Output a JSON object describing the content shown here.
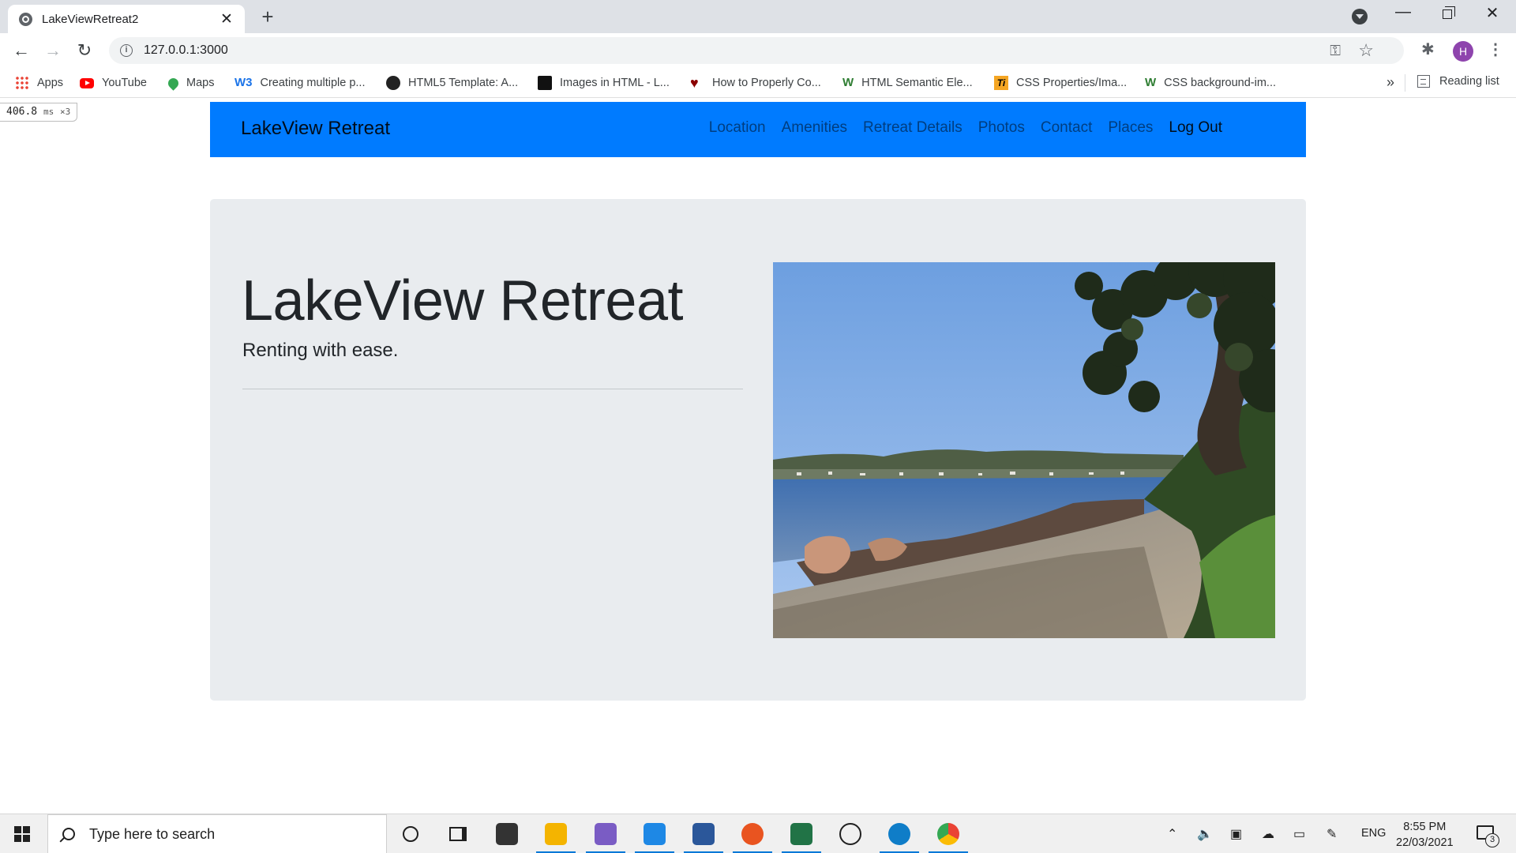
{
  "browser": {
    "tab_title": "LakeViewRetreat2",
    "new_tab_glyph": "+",
    "url": "127.0.0.1:3000",
    "profile_initial": "H",
    "bookmarks": [
      {
        "label": "Apps",
        "icon": "apps-grid-icon"
      },
      {
        "label": "YouTube",
        "icon": "youtube-icon"
      },
      {
        "label": "Maps",
        "icon": "maps-pin-icon"
      },
      {
        "label": "Creating multiple p...",
        "icon": "w3schools-icon"
      },
      {
        "label": "HTML5 Template: A...",
        "icon": "sitepoint-icon"
      },
      {
        "label": "Images in HTML - L...",
        "icon": "mdn-icon"
      },
      {
        "label": "How to Properly Co...",
        "icon": "heart-icon"
      },
      {
        "label": "HTML Semantic Ele...",
        "icon": "w3schools-green-icon"
      },
      {
        "label": "CSS Properties/Ima...",
        "icon": "tutorialspoint-icon"
      },
      {
        "label": "CSS background-im...",
        "icon": "w3schools-green-icon"
      }
    ],
    "bookmarks_overflow": "»",
    "reading_list": "Reading list"
  },
  "perf": {
    "value": "406.8",
    "unit": "ms",
    "multiplier": "×3"
  },
  "site": {
    "brand": "LakeView Retreat",
    "nav": [
      {
        "label": "Location",
        "active": false
      },
      {
        "label": "Amenities",
        "active": false
      },
      {
        "label": "Retreat Details",
        "active": false
      },
      {
        "label": "Photos",
        "active": false
      },
      {
        "label": "Contact",
        "active": false
      },
      {
        "label": "Places",
        "active": false
      },
      {
        "label": "Log Out",
        "active": true
      }
    ],
    "hero": {
      "title": "LakeView Retreat",
      "lead": "Renting with ease."
    },
    "colors": {
      "navbar": "#007bff",
      "jumbotron": "#e9ecef"
    }
  },
  "taskbar": {
    "search_placeholder": "Type here to search",
    "language": "ENG",
    "time": "8:55 PM",
    "date": "22/03/2021",
    "notification_count": "3"
  }
}
